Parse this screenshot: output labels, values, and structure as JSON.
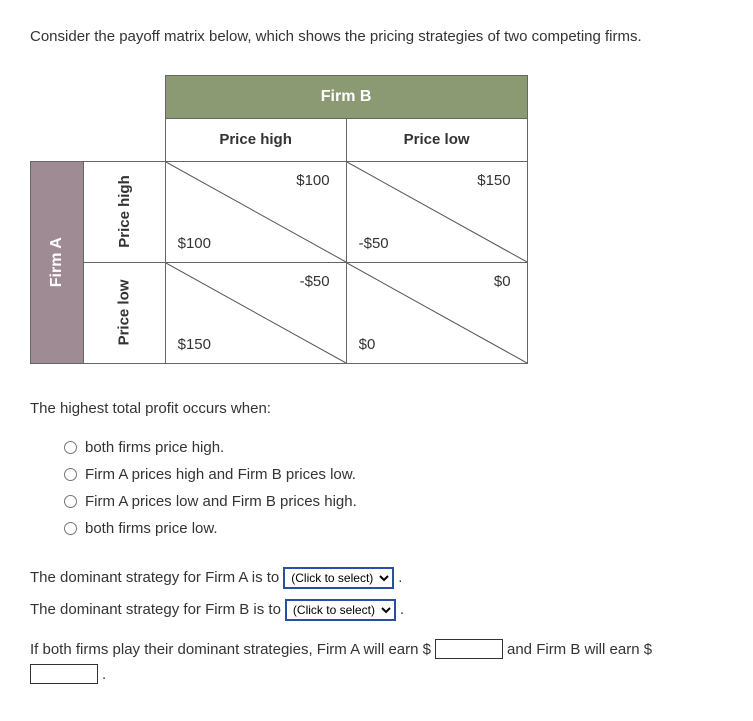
{
  "prompt": "Consider the payoff matrix below, which shows the pricing strategies of two competing firms.",
  "matrix": {
    "firm_b_label": "Firm B",
    "firm_a_label": "Firm A",
    "col_headers": [
      "Price high",
      "Price low"
    ],
    "row_headers": [
      "Price high",
      "Price low"
    ],
    "cells": {
      "hh": {
        "b": "$100",
        "a": "$100"
      },
      "hl": {
        "b": "$150",
        "a": "-$50"
      },
      "lh": {
        "b": "-$50",
        "a": "$150"
      },
      "ll": {
        "b": "$0",
        "a": "$0"
      }
    }
  },
  "q1": {
    "stem": "The highest total profit occurs when:",
    "options": [
      "both firms price high.",
      "Firm A prices high and Firm B prices low.",
      "Firm A prices low and Firm B prices high.",
      "both firms price low."
    ]
  },
  "dominant_a_text": "The dominant strategy for Firm A is to",
  "dominant_b_text": "The dominant strategy for Firm B is to",
  "select_placeholder": "(Click to select)",
  "earn_line": {
    "p1": "If both firms play their dominant strategies, Firm A will earn  $",
    "p2": " and Firm B will earn  $",
    "p3": " ."
  },
  "chart_data": {
    "type": "table",
    "description": "2x2 payoff matrix, diagonal split cells: upper-right value = Firm B payoff, lower-left value = Firm A payoff",
    "rows": [
      "Firm A Price high",
      "Firm A Price low"
    ],
    "cols": [
      "Firm B Price high",
      "Firm B Price low"
    ],
    "payoffs": [
      {
        "row": "Price high",
        "col": "Price high",
        "firm_a": 100,
        "firm_b": 100
      },
      {
        "row": "Price high",
        "col": "Price low",
        "firm_a": -50,
        "firm_b": 150
      },
      {
        "row": "Price low",
        "col": "Price high",
        "firm_a": 150,
        "firm_b": -50
      },
      {
        "row": "Price low",
        "col": "Price low",
        "firm_a": 0,
        "firm_b": 0
      }
    ]
  }
}
